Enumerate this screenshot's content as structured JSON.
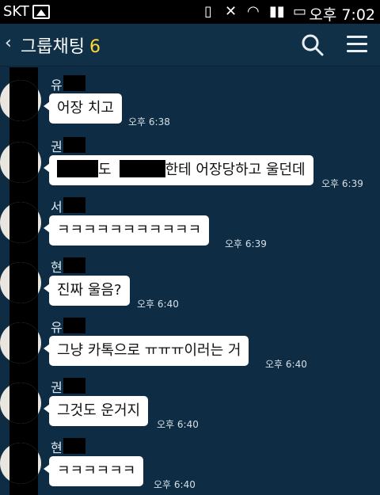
{
  "status_bar": {
    "carrier": "SKT",
    "time": "오후 7:02"
  },
  "header": {
    "back_icon": "‹",
    "title": "그룹채팅",
    "member_count": "6"
  },
  "messages": [
    {
      "sender": "유",
      "text": "어장 치고",
      "time": "오후 6:38"
    },
    {
      "sender": "권",
      "text_a": "도",
      "text_b": "한테 어장당하고 울던데",
      "time": "오후 6:39"
    },
    {
      "sender": "서",
      "text": "ㅋㅋㅋㅋㅋㅋㅋㅋㅋㅋㅋ",
      "time": "오후 6:39"
    },
    {
      "sender": "현",
      "text": "진짜 울음?",
      "time": "오후 6:40"
    },
    {
      "sender": "유",
      "text": "그냥 카톡으로 ㅠㅠㅠ이러는 거",
      "time": "오후 6:40"
    },
    {
      "sender": "권",
      "text": "그것도 운거지",
      "time": "오후 6:40"
    },
    {
      "sender": "현",
      "text": "ㅋㅋㅋㅋㅋㅋ",
      "time": "오후 6:40"
    }
  ]
}
